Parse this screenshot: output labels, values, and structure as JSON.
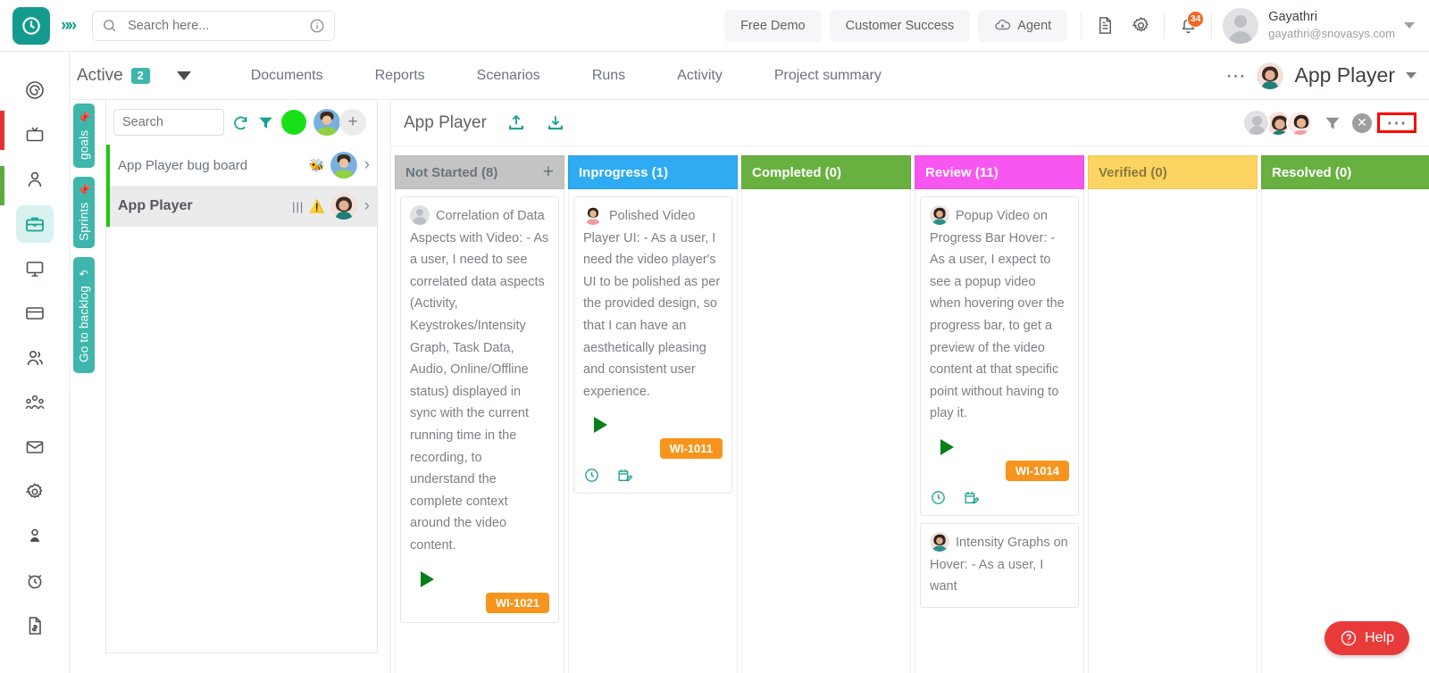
{
  "topbar": {
    "logo_icon": "clock-logo-icon",
    "expand_icon": "double-chevron-right-icon",
    "search": {
      "placeholder": "Search here...",
      "value": "",
      "icon": "search-icon",
      "info_icon": "info-icon"
    },
    "free_demo_label": "Free Demo",
    "customer_success_label": "Customer Success",
    "agent_label": "Agent",
    "agent_icon": "cloud-download-icon",
    "doc_icon": "document-icon",
    "gear_icon": "gear-icon",
    "bell_icon": "bell-icon",
    "notification_count": "34",
    "user_name": "Gayathri",
    "user_email": "gayathri@snovasys.com",
    "user_caret_icon": "chevron-down-icon"
  },
  "navbar": {
    "active_label": "Active",
    "active_count": "2",
    "dropdown_icon": "caret-down-icon",
    "tabs": [
      {
        "label": "Documents"
      },
      {
        "label": "Reports"
      },
      {
        "label": "Scenarios"
      },
      {
        "label": "Runs"
      },
      {
        "label": "Activity"
      },
      {
        "label": "Project summary"
      }
    ],
    "more_icon": "ellipsis-icon",
    "project_name": "App Player",
    "project_caret_icon": "chevron-down-icon"
  },
  "rail": {
    "items": [
      {
        "name": "spiral-target-icon"
      },
      {
        "name": "tv-icon"
      },
      {
        "name": "user-icon"
      },
      {
        "name": "briefcase-icon",
        "active": true
      },
      {
        "name": "monitor-icon"
      },
      {
        "name": "credit-card-icon"
      },
      {
        "name": "users-icon"
      },
      {
        "name": "team-group-icon"
      },
      {
        "name": "mail-icon"
      },
      {
        "name": "settings-gear-icon"
      },
      {
        "name": "person-badge-icon"
      },
      {
        "name": "alarm-clock-icon"
      },
      {
        "name": "invoice-icon"
      }
    ]
  },
  "sidetabs": [
    {
      "label": "goals",
      "icon": "pin-icon"
    },
    {
      "label": "Sprints",
      "icon": "pin-icon"
    },
    {
      "label": "Go to backlog",
      "icon": "arrow-back-icon"
    }
  ],
  "listpanel": {
    "search": {
      "placeholder": "Search",
      "value": ""
    },
    "refresh_icon": "refresh-icon",
    "filter_icon": "filter-icon",
    "status_dot": "green-status-dot",
    "add_icon": "plus-icon",
    "rows": [
      {
        "title": "App Player bug board",
        "bug_icon": "bug-icon",
        "chevron_icon": "chevron-right-icon",
        "selected": false
      },
      {
        "title": "App Player",
        "bars_icon": "bars-icon",
        "warning_icon": "warning-triangle-icon",
        "chevron_icon": "chevron-right-icon",
        "selected": true
      }
    ]
  },
  "board": {
    "title": "App Player",
    "upload_icon": "upload-icon",
    "download_icon": "download-icon",
    "filter_icon": "filter-icon",
    "clear_icon": "clear-circle-icon",
    "more_icon": "ellipsis-icon",
    "columns": [
      {
        "title": "Not Started (8)",
        "color": "#c4c4c4",
        "has_add": true,
        "add_label": "+",
        "cards": [
          {
            "avatar": "generic-avatar",
            "text": "Correlation of Data Aspects with Video: - As a user, I need to see correlated data aspects (Activity, Keystrokes/Intensity Graph, Task Data, Audio, Online/Offline status) displayed in sync with the current running time in the recording, to understand the complete context around the video content.",
            "play_icon": "play-icon",
            "id": "WI-1021",
            "show_foot": false
          }
        ]
      },
      {
        "title": "Inprogress (1)",
        "color": "#2eabf2",
        "has_add": false,
        "cards": [
          {
            "avatar": "user-avatar",
            "text": "Polished Video Player UI: - As a user, I need the video player's UI to be polished as per the provided design, so that I can have an aesthetically pleasing and consistent user experience.",
            "play_icon": "play-icon",
            "id": "WI-1011",
            "show_foot": true,
            "clock_icon": "clock-icon",
            "calendar_icon": "calendar-edit-icon"
          }
        ]
      },
      {
        "title": "Completed (0)",
        "color": "#68b141",
        "has_add": false,
        "cards": []
      },
      {
        "title": "Review (11)",
        "color": "#f756f0",
        "has_add": false,
        "cards": [
          {
            "avatar": "user-avatar",
            "text": "Popup Video on Progress Bar Hover: - As a user, I expect to see a popup video when hovering over the progress bar, to get a preview of the video content at that specific point without having to play it.",
            "play_icon": "play-icon",
            "id": "WI-1014",
            "show_foot": true,
            "clock_icon": "clock-icon",
            "calendar_icon": "calendar-edit-icon"
          },
          {
            "avatar": "user-avatar",
            "text": "Intensity Graphs on Hover: - As a user, I want",
            "partial": true
          }
        ]
      },
      {
        "title": "Verified (0)",
        "color": "#fcd462",
        "has_add": false,
        "cards": []
      },
      {
        "title": "Resolved (0)",
        "color": "#68b141",
        "has_add": false,
        "cards": []
      }
    ]
  },
  "help": {
    "label": "Help",
    "icon": "question-circle-icon"
  }
}
